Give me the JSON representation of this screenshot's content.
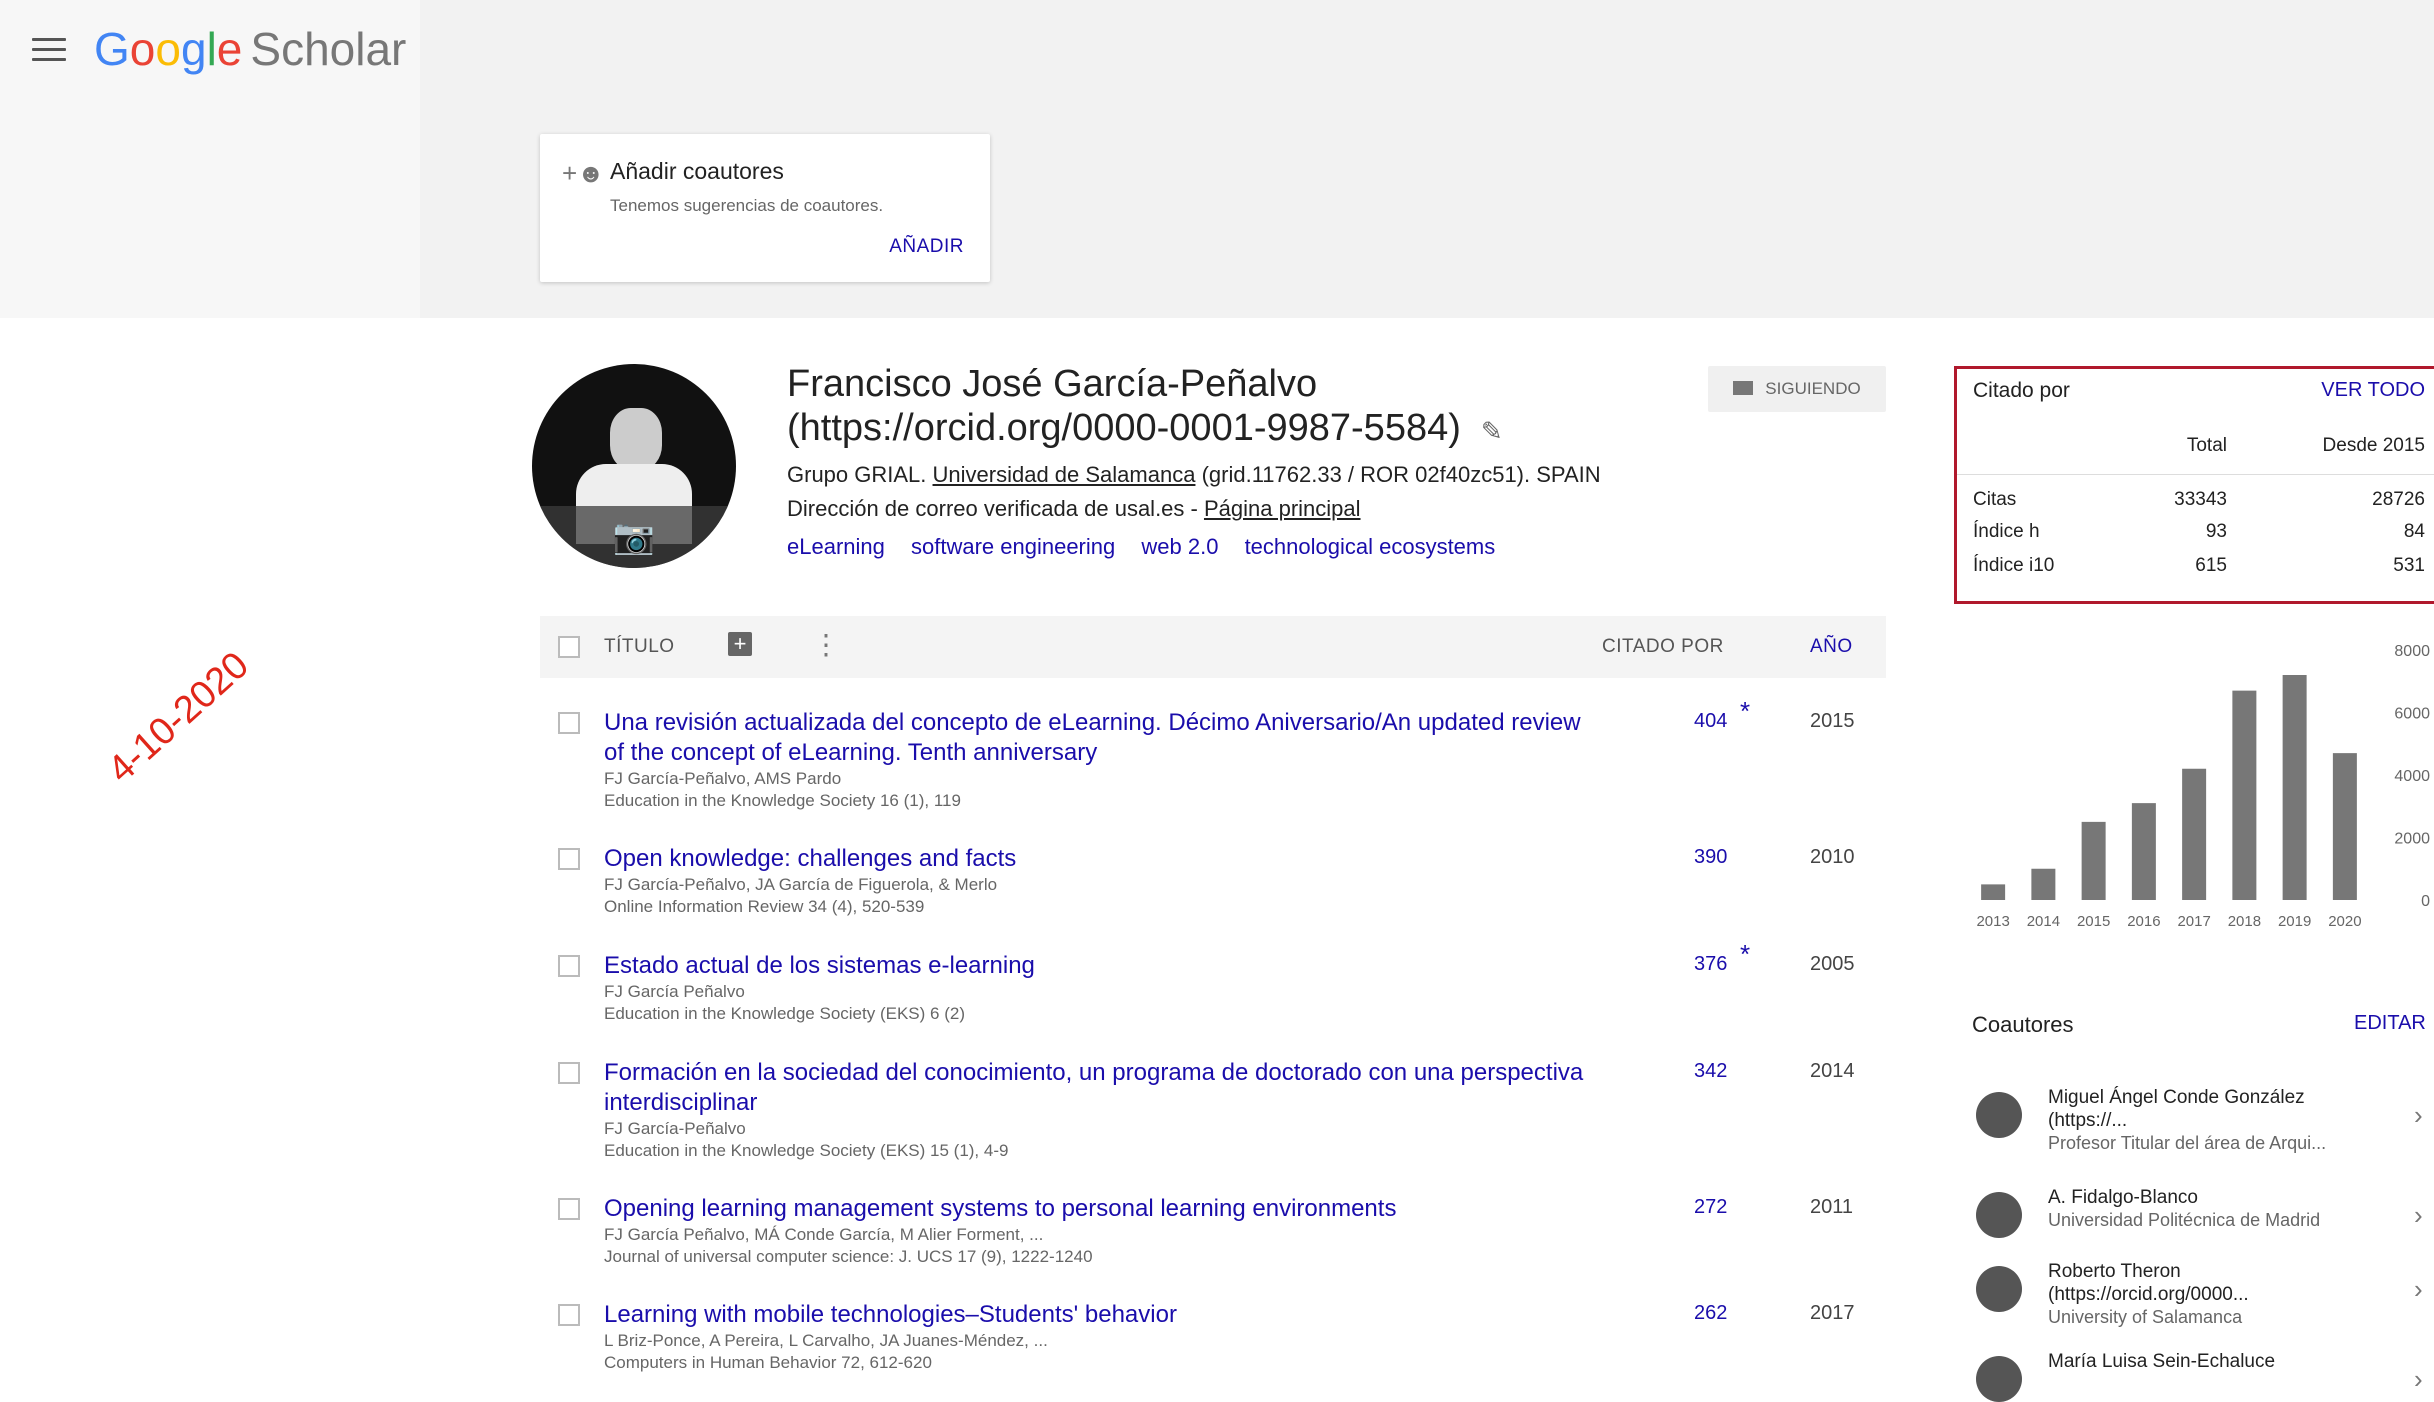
{
  "header": {
    "logo_google": "Google",
    "logo_scholar": "Scholar"
  },
  "add_coauthors": {
    "title": "Añadir coautores",
    "subtitle": "Tenemos sugerencias de coautores.",
    "button": "AÑADIR"
  },
  "profile": {
    "name_line1": "Francisco José García-Peñalvo",
    "name_line2": "(https://orcid.org/0000-0001-9987-5584)",
    "affil_prefix": "Grupo GRIAL. ",
    "affil_link": "Universidad de Salamanca",
    "affil_suffix": " (grid.11762.33 / ROR 02f40zc51). SPAIN",
    "email_text": "Dirección de correo verificada de usal.es - ",
    "homepage": "Página principal",
    "interests": [
      "eLearning",
      "software engineering",
      "web 2.0",
      "technological ecosystems"
    ],
    "follow_label": "SIGUIENDO"
  },
  "table": {
    "col_title": "TÍTULO",
    "col_cited": "CITADO POR",
    "col_year": "AÑO",
    "rows": [
      {
        "title": "Una revisión actualizada del concepto de eLearning. Décimo Aniversario/An updated review of the concept of eLearning. Tenth anniversary",
        "authors": "FJ García-Peñalvo, AMS Pardo",
        "venue": "Education in the Knowledge Society 16 (1), 119",
        "cites": "404",
        "star": "*",
        "year": "2015"
      },
      {
        "title": "Open knowledge: challenges and facts",
        "authors": "FJ García-Peñalvo, JA García de Figuerola, & Merlo",
        "venue": "Online Information Review 34 (4), 520-539",
        "cites": "390",
        "star": "",
        "year": "2010"
      },
      {
        "title": "Estado actual de los sistemas e-learning",
        "authors": "FJ García Peñalvo",
        "venue": "Education in the Knowledge Society (EKS) 6 (2)",
        "cites": "376",
        "star": "*",
        "year": "2005"
      },
      {
        "title": "Formación en la sociedad del conocimiento, un programa de doctorado con una perspectiva interdisciplinar",
        "authors": "FJ García-Peñalvo",
        "venue": "Education in the Knowledge Society (EKS) 15 (1), 4-9",
        "cites": "342",
        "star": "",
        "year": "2014"
      },
      {
        "title": "Opening learning management systems to personal learning environments",
        "authors": "FJ García Peñalvo, MÁ Conde García, M Alier Forment, ...",
        "venue": "Journal of universal computer science: J. UCS 17 (9), 1222-1240",
        "cites": "272",
        "star": "",
        "year": "2011"
      },
      {
        "title": "Learning with mobile technologies–Students' behavior",
        "authors": "L Briz-Ponce, A Pereira, L Carvalho, JA Juanes-Méndez, ...",
        "venue": "Computers in Human Behavior 72, 612-620",
        "cites": "262",
        "star": "",
        "year": "2017"
      }
    ]
  },
  "cited_by": {
    "title": "Citado por",
    "view_all": "VER TODO",
    "col_total": "Total",
    "col_since": "Desde 2015",
    "rows": [
      {
        "label": "Citas",
        "total": "33343",
        "since": "28726"
      },
      {
        "label": "Índice h",
        "total": "93",
        "since": "84"
      },
      {
        "label": "Índice i10",
        "total": "615",
        "since": "531"
      }
    ]
  },
  "chart_data": {
    "type": "bar",
    "categories": [
      "2013",
      "2014",
      "2015",
      "2016",
      "2017",
      "2018",
      "2019",
      "2020"
    ],
    "values": [
      500,
      1000,
      2500,
      3100,
      4200,
      6700,
      7200,
      4700
    ],
    "ylim": [
      0,
      8000
    ],
    "yticks": [
      "8000",
      "6000",
      "4000",
      "2000",
      "0"
    ],
    "title": "",
    "xlabel": "",
    "ylabel": "",
    "bar_color": "#777777"
  },
  "coauthors": {
    "title": "Coautores",
    "edit": "EDITAR",
    "items": [
      {
        "name": "Miguel Ángel Conde González (https://...",
        "affil": "Profesor Titular del área de Arqui..."
      },
      {
        "name": "A. Fidalgo-Blanco",
        "affil": "Universidad Politécnica de Madrid"
      },
      {
        "name": "Roberto Theron (https://orcid.org/0000...",
        "affil": "University of Salamanca"
      },
      {
        "name": "María Luisa Sein-Echaluce",
        "affil": ""
      }
    ]
  },
  "stamp": {
    "date": "4-10-2020"
  },
  "colors": {
    "link": "#1a0dab",
    "highlight_border": "#b0182c",
    "stamp": "#e0271a"
  }
}
